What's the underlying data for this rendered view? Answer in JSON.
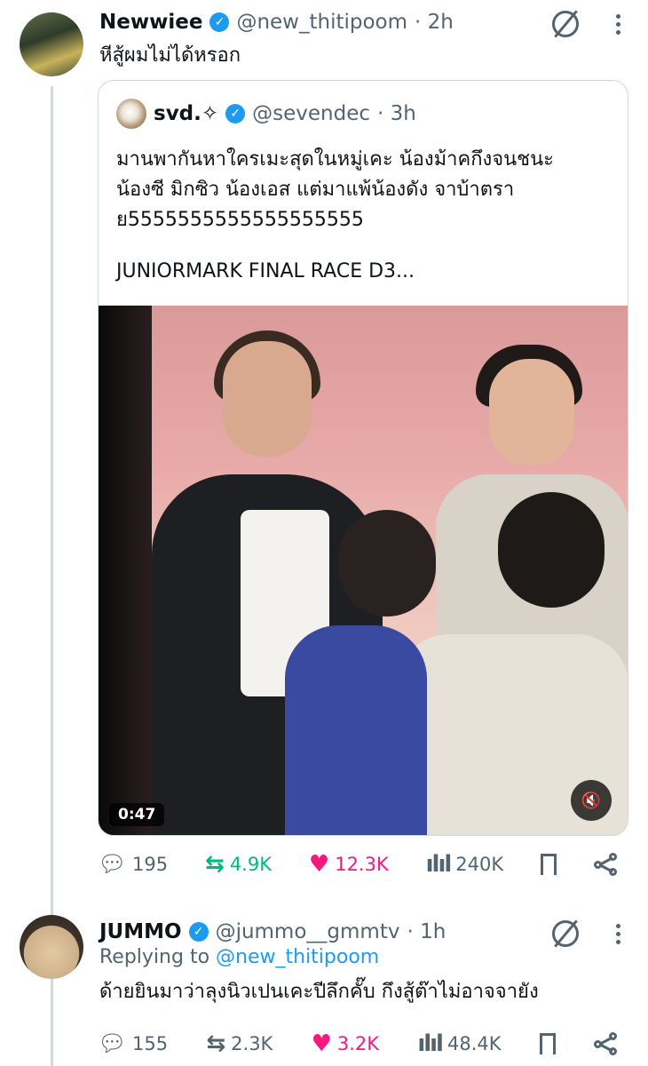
{
  "tweet1": {
    "author_name": "Newwiee",
    "handle": "@new_thitipoom",
    "time": "· 2h",
    "text": "หีสู้ผมไม่ได้หรอก",
    "quote": {
      "author_name": "svd.✧",
      "handle": "@sevendec",
      "time": "· 3h",
      "lines": [
        "มานพากันหาใครเมะสุดในหมู่เคะ น้องม้าคกึงจนชนะ",
        "น้องซี มิกซิว น้องเอส แต่มาแพ้น้องดัง จาบ้าตรา",
        "ย5555555555555555555"
      ],
      "tail_line": "JUNIORMARK FINAL RACE D3...",
      "video_duration": "0:47"
    },
    "stats": {
      "replies": "195",
      "retweets": "4.9K",
      "likes": "12.3K",
      "views": "240K"
    }
  },
  "tweet2": {
    "author_name": "JUMMO",
    "handle": "@jummo__gmmtv",
    "time": "· 1h",
    "replying_prefix": "Replying to",
    "replying_to": "@new_thitipoom",
    "text": "ด้ายยินมาว่าลุงนิวเปนเคะปีลึกคั๊บ กึงสู้ต๊าไม่อาจจายัง",
    "stats": {
      "replies": "155",
      "retweets": "2.3K",
      "likes": "3.2K",
      "views": "48.4K"
    }
  },
  "icons": {
    "verified": "verified-badge-icon",
    "mute": "grok-icon",
    "more": "more-icon",
    "reply": "reply-icon",
    "retweet": "retweet-icon",
    "like": "heart-icon",
    "views": "views-icon",
    "bookmark": "bookmark-icon",
    "share": "share-icon"
  },
  "colors": {
    "accent": "#1d9bf0",
    "retweet": "#00ba7c",
    "like": "#f91880",
    "muted_text": "#536471"
  }
}
